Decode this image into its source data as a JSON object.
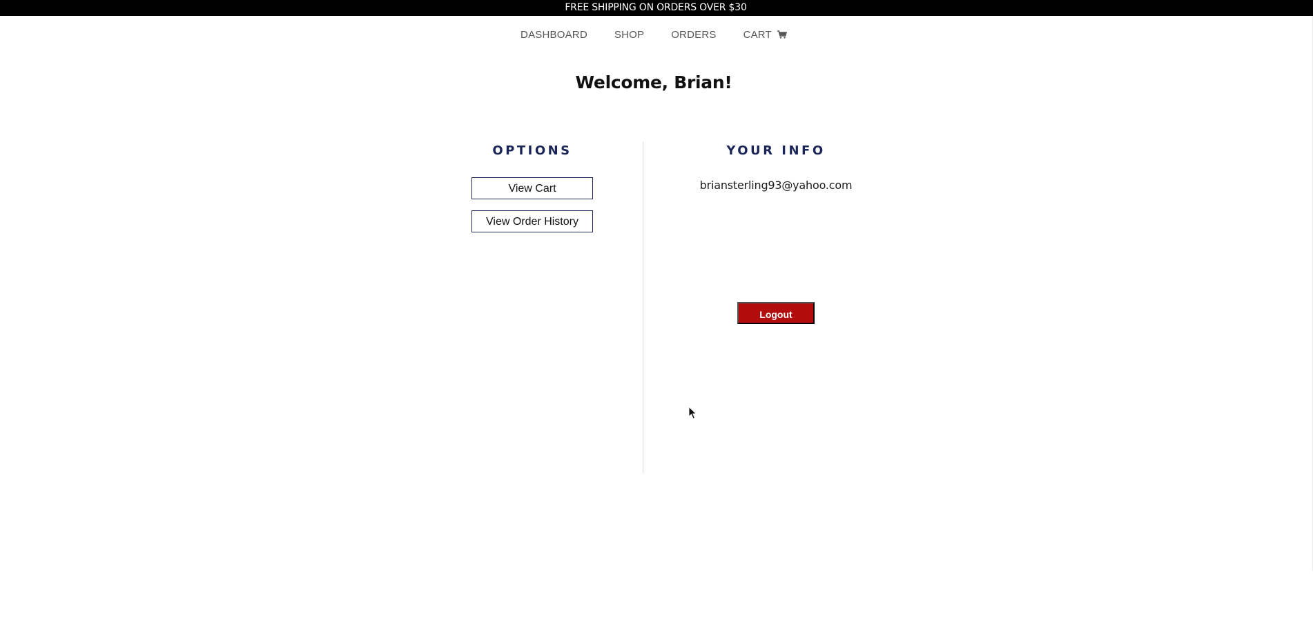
{
  "promo": {
    "text": "FREE SHIPPING ON ORDERS OVER $30"
  },
  "nav": {
    "items": [
      {
        "label": "DASHBOARD"
      },
      {
        "label": "SHOP"
      },
      {
        "label": "ORDERS"
      },
      {
        "label": "CART"
      }
    ],
    "cart_icon": "shopping-cart-icon"
  },
  "welcome": {
    "text": "Welcome, Brian!"
  },
  "options": {
    "title": "OPTIONS",
    "view_cart_label": "View Cart",
    "view_order_history_label": "View Order History"
  },
  "info": {
    "title": "YOUR INFO",
    "email": "briansterling93@yahoo.com",
    "logout_label": "Logout"
  },
  "colors": {
    "promo_background": "#000000",
    "heading_navy": "#1a2457",
    "logout_red": "#b20c0c"
  }
}
